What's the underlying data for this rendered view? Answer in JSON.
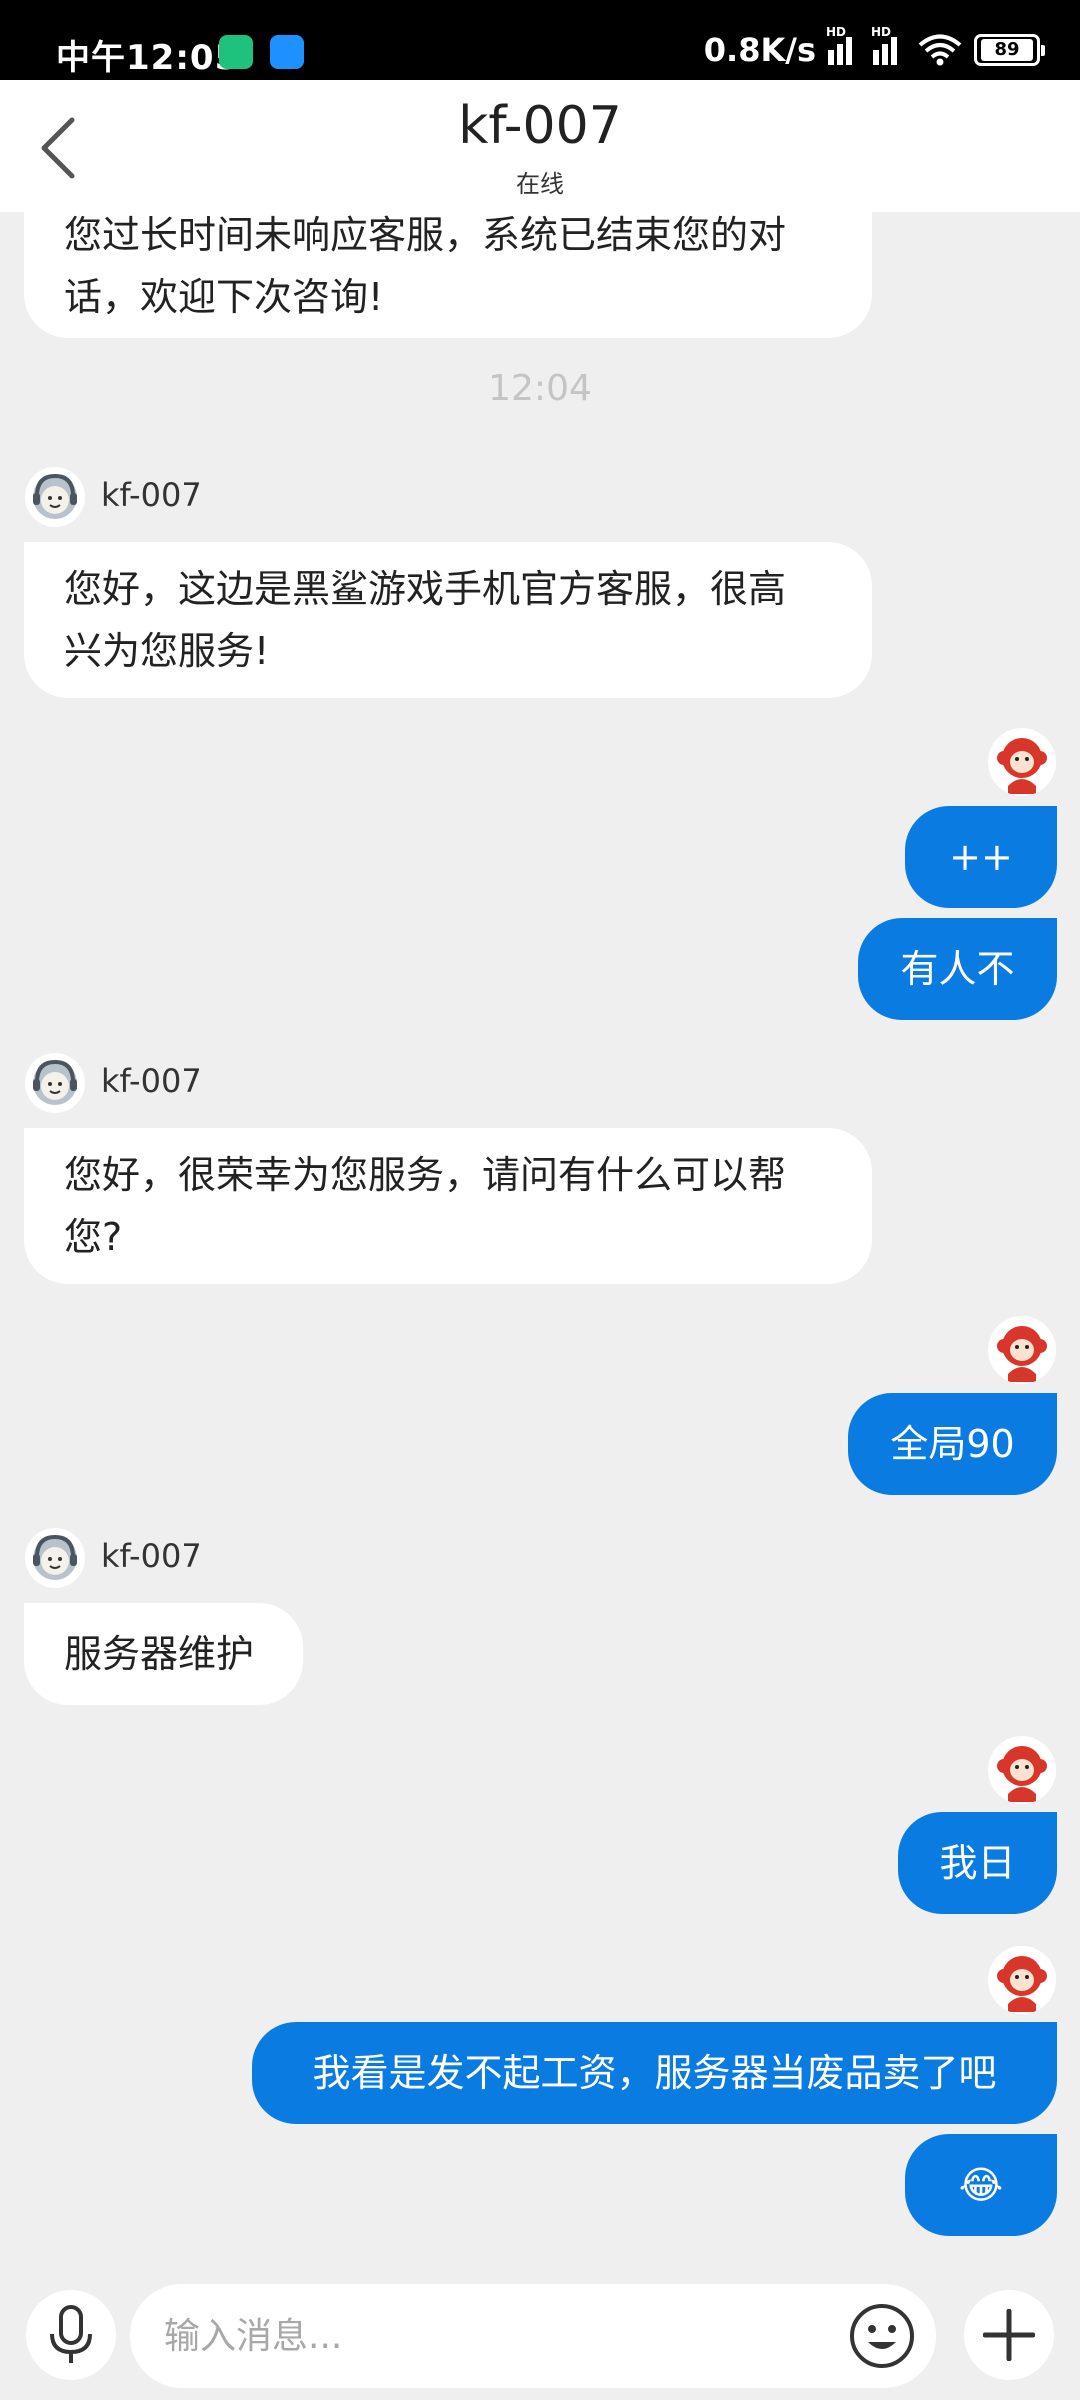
{
  "status_bar": {
    "time": "中午12:05",
    "net_speed": "0.8K/s",
    "signal_label": "HD",
    "battery": "89"
  },
  "header": {
    "title": "kf-007",
    "status": "在线"
  },
  "messages": {
    "m0": {
      "text_line1": "您过长时间未响应客服，系统已结束您的对",
      "text_line2": "话，欢迎下次咨询!"
    },
    "timestamp": "12:04",
    "kf1": {
      "name": "kf-007",
      "text_line1": "您好，这边是黑鲨游戏手机官方客服，很高",
      "text_line2": "兴为您服务!"
    },
    "u1": "++",
    "u2": "有人不",
    "kf2": {
      "name": "kf-007",
      "text_line1": "您好，很荣幸为您服务，请问有什么可以帮",
      "text_line2": "您?"
    },
    "u3": "全局90",
    "kf3": {
      "name": "kf-007",
      "text": "服务器维护"
    },
    "u4": "我日",
    "u5": "我看是发不起工资，服务器当废品卖了吧",
    "u6": "😂"
  },
  "input": {
    "placeholder": "输入消息...",
    "value": ""
  },
  "colors": {
    "outgoing_bubble": "#0a7be0",
    "background": "#efefef"
  }
}
